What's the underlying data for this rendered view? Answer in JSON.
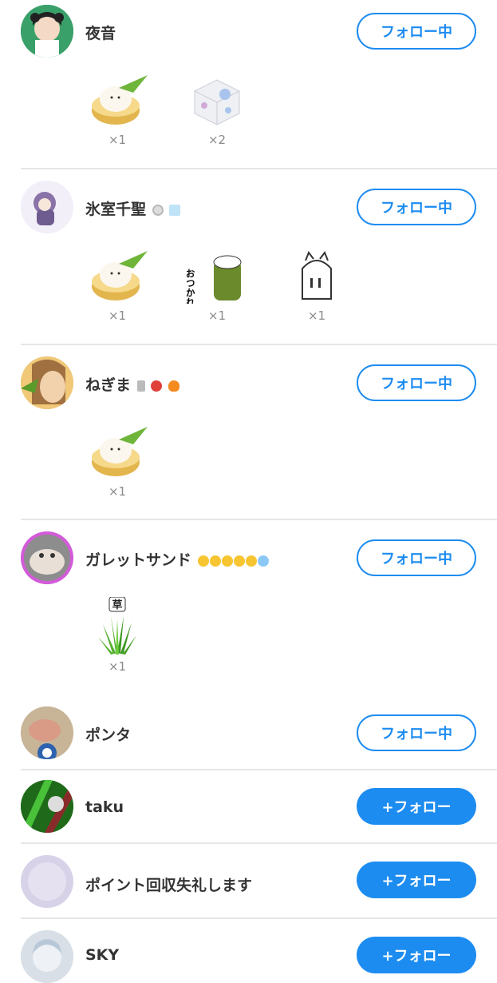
{
  "users": [
    {
      "name": "夜音",
      "button": "フォロー中",
      "gifts": [
        {
          "icon": "dumpling-icon",
          "count": "×1"
        },
        {
          "icon": "dice-icon",
          "count": "×2"
        }
      ]
    },
    {
      "name": "氷室千聖",
      "button": "フォロー中",
      "gifts": [
        {
          "icon": "dumpling-icon",
          "count": "×1"
        },
        {
          "icon": "otsukaresama-icon",
          "count": "×1"
        },
        {
          "icon": "cat-ghost-icon",
          "count": "×1"
        }
      ]
    },
    {
      "name": "ねぎま",
      "button": "フォロー中",
      "gifts": [
        {
          "icon": "dumpling-icon",
          "count": "×1"
        }
      ]
    },
    {
      "name": "ガレットサンド",
      "button": "フォロー中",
      "gifts": [
        {
          "icon": "grass-icon",
          "count": "×1"
        }
      ]
    },
    {
      "name": "ポンタ",
      "button": "フォロー中"
    },
    {
      "name": "taku",
      "button": "+フォロー"
    },
    {
      "name": "ポイント回収失礼します",
      "button": "+フォロー"
    },
    {
      "name": "SKY",
      "button": "+フォロー"
    }
  ],
  "grass_label": "草",
  "otsukare_label": "おつかれさま",
  "colors": {
    "accent": "#1d8cf0",
    "divider": "#e6e6e6",
    "text": "#333333",
    "count": "#8a8a8a"
  }
}
